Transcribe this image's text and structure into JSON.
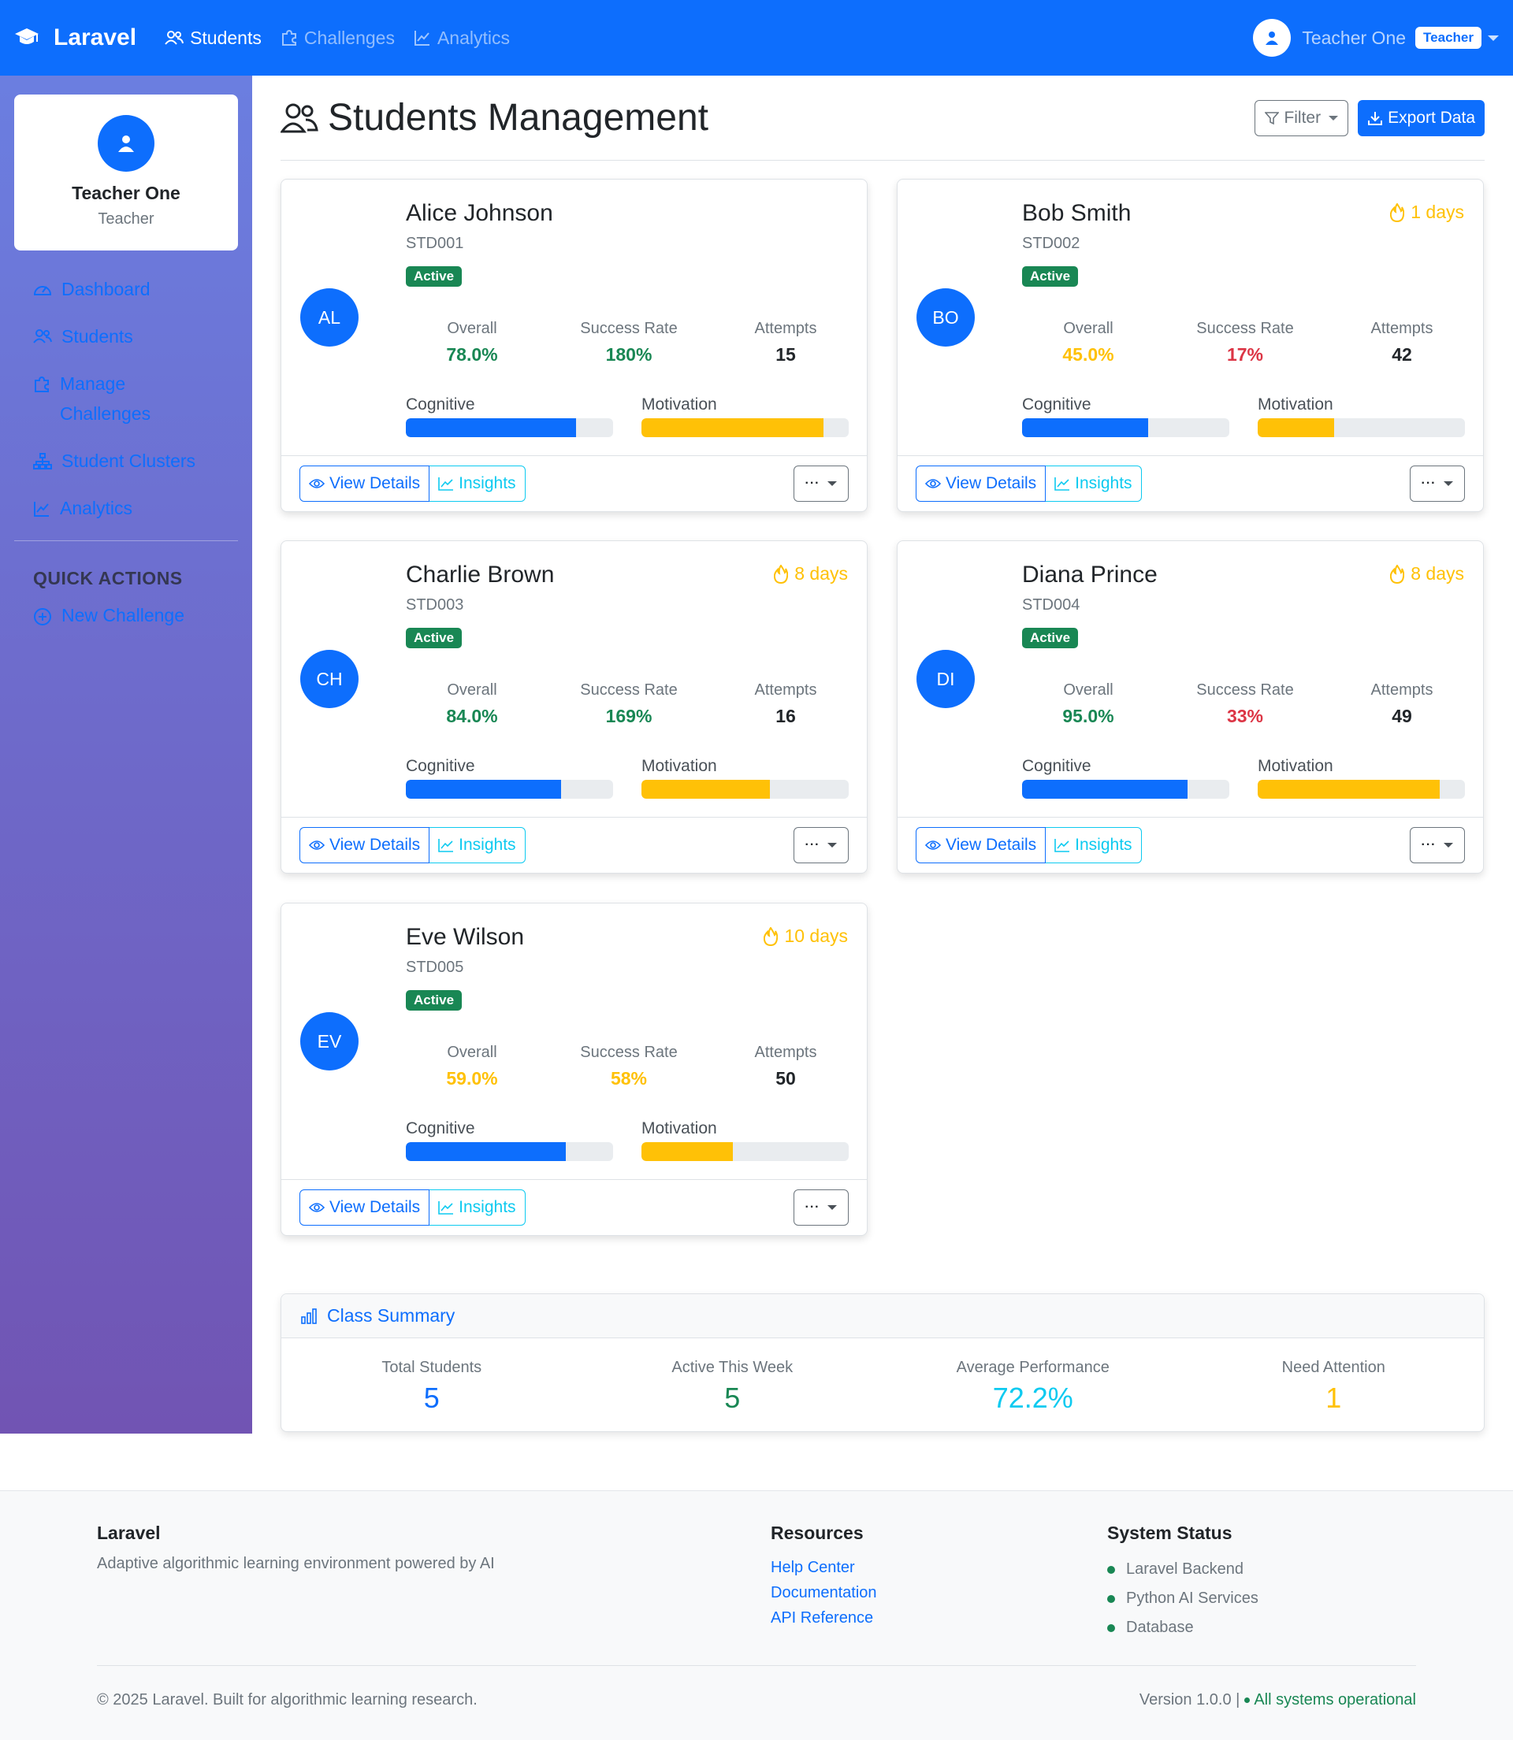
{
  "navbar": {
    "brand": "Laravel",
    "links": [
      {
        "label": "Students",
        "active": true
      },
      {
        "label": "Challenges",
        "active": false
      },
      {
        "label": "Analytics",
        "active": false
      }
    ],
    "user_name": "Teacher One",
    "user_role_badge": "Teacher"
  },
  "sidebar": {
    "profile_name": "Teacher One",
    "profile_role": "Teacher",
    "items": [
      {
        "label": "Dashboard",
        "icon": "speedometer-icon"
      },
      {
        "label": "Students",
        "icon": "people-icon"
      },
      {
        "label": "Manage Challenges",
        "icon": "puzzle-icon"
      },
      {
        "label": "Student Clusters",
        "icon": "diagram-icon"
      },
      {
        "label": "Analytics",
        "icon": "graph-icon"
      }
    ],
    "quick_actions_title": "QUICK ACTIONS",
    "quick_actions": [
      {
        "label": "New Challenge",
        "icon": "plus-circle-icon"
      }
    ]
  },
  "header": {
    "title": "Students Management",
    "filter_label": "Filter",
    "export_label": "Export Data"
  },
  "labels": {
    "overall": "Overall",
    "success_rate": "Success Rate",
    "attempts": "Attempts",
    "cognitive": "Cognitive",
    "motivation": "Motivation",
    "view_details": "View Details",
    "insights": "Insights",
    "more": "···"
  },
  "colors": {
    "primary": "#0d6efd",
    "success": "#198754",
    "warning": "#ffc107",
    "danger": "#dc3545",
    "info": "#0dcaf0"
  },
  "students": [
    {
      "initials": "AL",
      "name": "Alice Johnson",
      "id": "STD001",
      "status": "Active",
      "streak": "",
      "overall": "78.0%",
      "overall_color": "success",
      "success_rate": "180%",
      "success_color": "success",
      "attempts": "15",
      "cognitive": 0.82,
      "motivation": 0.88
    },
    {
      "initials": "BO",
      "name": "Bob Smith",
      "id": "STD002",
      "status": "Active",
      "streak": "1 days",
      "overall": "45.0%",
      "overall_color": "warning",
      "success_rate": "17%",
      "success_color": "danger",
      "attempts": "42",
      "cognitive": 0.61,
      "motivation": 0.37
    },
    {
      "initials": "CH",
      "name": "Charlie Brown",
      "id": "STD003",
      "status": "Active",
      "streak": "8 days",
      "overall": "84.0%",
      "overall_color": "success",
      "success_rate": "169%",
      "success_color": "success",
      "attempts": "16",
      "cognitive": 0.75,
      "motivation": 0.62
    },
    {
      "initials": "DI",
      "name": "Diana Prince",
      "id": "STD004",
      "status": "Active",
      "streak": "8 days",
      "overall": "95.0%",
      "overall_color": "success",
      "success_rate": "33%",
      "success_color": "danger",
      "attempts": "49",
      "cognitive": 0.8,
      "motivation": 0.88
    },
    {
      "initials": "EV",
      "name": "Eve Wilson",
      "id": "STD005",
      "status": "Active",
      "streak": "10 days",
      "overall": "59.0%",
      "overall_color": "warning",
      "success_rate": "58%",
      "success_color": "warning",
      "attempts": "50",
      "cognitive": 0.77,
      "motivation": 0.44
    }
  ],
  "summary": {
    "title": "Class Summary",
    "items": [
      {
        "label": "Total Students",
        "value": "5",
        "color": "primary"
      },
      {
        "label": "Active This Week",
        "value": "5",
        "color": "success"
      },
      {
        "label": "Average Performance",
        "value": "72.2%",
        "color": "info"
      },
      {
        "label": "Need Attention",
        "value": "1",
        "color": "warning"
      }
    ]
  },
  "footer": {
    "brand": "Laravel",
    "description": "Adaptive algorithmic learning environment powered by AI",
    "resources_title": "Resources",
    "resources": [
      "Help Center",
      "Documentation",
      "API Reference"
    ],
    "status_title": "System Status",
    "statuses": [
      "Laravel Backend",
      "Python AI Services",
      "Database"
    ],
    "copyright": "© 2025 Laravel. Built for algorithmic learning research.",
    "version": "Version 1.0.0 |",
    "operational": "All systems operational"
  }
}
